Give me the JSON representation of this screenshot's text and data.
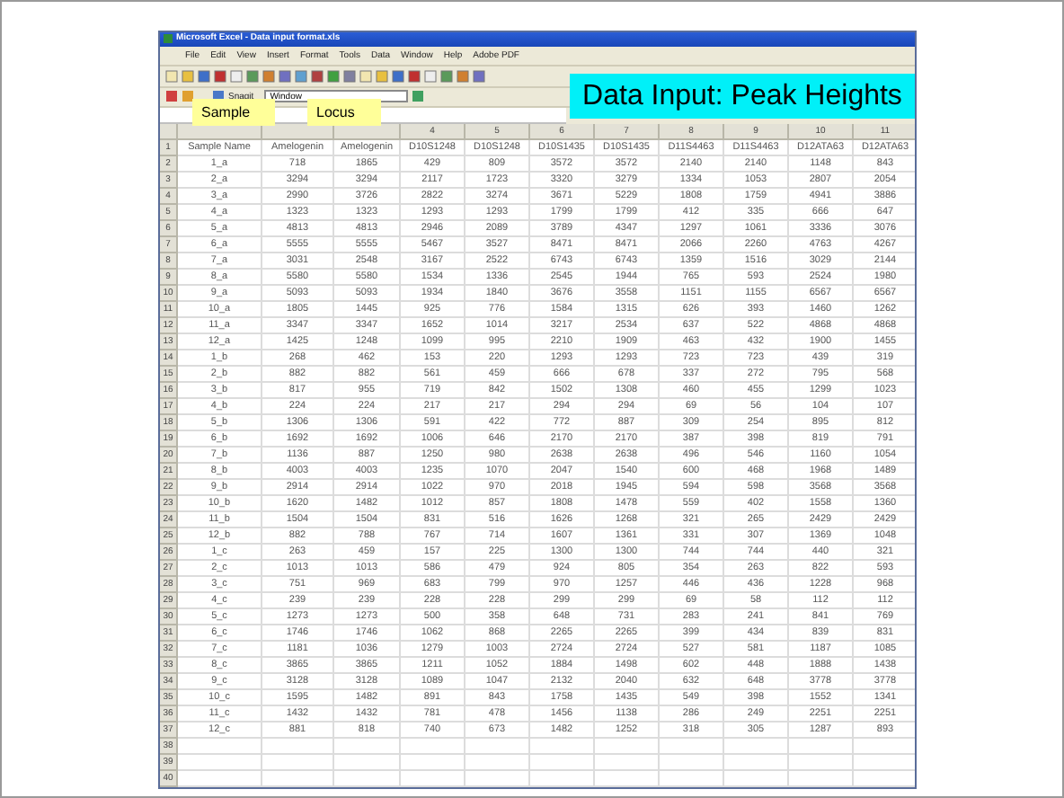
{
  "window": {
    "title": "Microsoft Excel - Data input format.xls"
  },
  "menu": [
    "File",
    "Edit",
    "View",
    "Insert",
    "Format",
    "Tools",
    "Data",
    "Window",
    "Help",
    "Adobe PDF"
  ],
  "toolbar2": {
    "snagit": "Snagit",
    "window_box": "Window"
  },
  "callouts": [
    {
      "kind": "title",
      "text": "Data Input: Peak Heights"
    },
    {
      "kind": "sample",
      "text": "Sample"
    },
    {
      "kind": "locus",
      "text": "Locus"
    }
  ],
  "column_headers": [
    "4",
    "5",
    "6",
    "7",
    "8",
    "9",
    "10",
    "11"
  ],
  "rows": [
    {
      "number": "1",
      "cells": [
        "Sample Name",
        "Amelogenin",
        "Amelogenin",
        "D10S1248",
        "D10S1248",
        "D10S1435",
        "D10S1435",
        "D11S4463",
        "D11S4463",
        "D12ATA63",
        "D12ATA63"
      ]
    },
    {
      "number": "2",
      "cells": [
        "1_a",
        "718",
        "1865",
        "429",
        "809",
        "3572",
        "3572",
        "2140",
        "2140",
        "1148",
        "843"
      ]
    },
    {
      "number": "3",
      "cells": [
        "2_a",
        "3294",
        "3294",
        "2117",
        "1723",
        "3320",
        "3279",
        "1334",
        "1053",
        "2807",
        "2054"
      ]
    },
    {
      "number": "4",
      "cells": [
        "3_a",
        "2990",
        "3726",
        "2822",
        "3274",
        "3671",
        "5229",
        "1808",
        "1759",
        "4941",
        "3886"
      ]
    },
    {
      "number": "5",
      "cells": [
        "4_a",
        "1323",
        "1323",
        "1293",
        "1293",
        "1799",
        "1799",
        "412",
        "335",
        "666",
        "647"
      ]
    },
    {
      "number": "6",
      "cells": [
        "5_a",
        "4813",
        "4813",
        "2946",
        "2089",
        "3789",
        "4347",
        "1297",
        "1061",
        "3336",
        "3076"
      ]
    },
    {
      "number": "7",
      "cells": [
        "6_a",
        "5555",
        "5555",
        "5467",
        "3527",
        "8471",
        "8471",
        "2066",
        "2260",
        "4763",
        "4267"
      ]
    },
    {
      "number": "8",
      "cells": [
        "7_a",
        "3031",
        "2548",
        "3167",
        "2522",
        "6743",
        "6743",
        "1359",
        "1516",
        "3029",
        "2144"
      ]
    },
    {
      "number": "9",
      "cells": [
        "8_a",
        "5580",
        "5580",
        "1534",
        "1336",
        "2545",
        "1944",
        "765",
        "593",
        "2524",
        "1980"
      ]
    },
    {
      "number": "10",
      "cells": [
        "9_a",
        "5093",
        "5093",
        "1934",
        "1840",
        "3676",
        "3558",
        "1151",
        "1155",
        "6567",
        "6567"
      ]
    },
    {
      "number": "11",
      "cells": [
        "10_a",
        "1805",
        "1445",
        "925",
        "776",
        "1584",
        "1315",
        "626",
        "393",
        "1460",
        "1262"
      ]
    },
    {
      "number": "12",
      "cells": [
        "11_a",
        "3347",
        "3347",
        "1652",
        "1014",
        "3217",
        "2534",
        "637",
        "522",
        "4868",
        "4868"
      ]
    },
    {
      "number": "13",
      "cells": [
        "12_a",
        "1425",
        "1248",
        "1099",
        "995",
        "2210",
        "1909",
        "463",
        "432",
        "1900",
        "1455"
      ]
    },
    {
      "number": "14",
      "cells": [
        "1_b",
        "268",
        "462",
        "153",
        "220",
        "1293",
        "1293",
        "723",
        "723",
        "439",
        "319"
      ]
    },
    {
      "number": "15",
      "cells": [
        "2_b",
        "882",
        "882",
        "561",
        "459",
        "666",
        "678",
        "337",
        "272",
        "795",
        "568"
      ]
    },
    {
      "number": "16",
      "cells": [
        "3_b",
        "817",
        "955",
        "719",
        "842",
        "1502",
        "1308",
        "460",
        "455",
        "1299",
        "1023"
      ]
    },
    {
      "number": "17",
      "cells": [
        "4_b",
        "224",
        "224",
        "217",
        "217",
        "294",
        "294",
        "69",
        "56",
        "104",
        "107"
      ]
    },
    {
      "number": "18",
      "cells": [
        "5_b",
        "1306",
        "1306",
        "591",
        "422",
        "772",
        "887",
        "309",
        "254",
        "895",
        "812"
      ]
    },
    {
      "number": "19",
      "cells": [
        "6_b",
        "1692",
        "1692",
        "1006",
        "646",
        "2170",
        "2170",
        "387",
        "398",
        "819",
        "791"
      ]
    },
    {
      "number": "20",
      "cells": [
        "7_b",
        "1136",
        "887",
        "1250",
        "980",
        "2638",
        "2638",
        "496",
        "546",
        "1160",
        "1054"
      ]
    },
    {
      "number": "21",
      "cells": [
        "8_b",
        "4003",
        "4003",
        "1235",
        "1070",
        "2047",
        "1540",
        "600",
        "468",
        "1968",
        "1489"
      ]
    },
    {
      "number": "22",
      "cells": [
        "9_b",
        "2914",
        "2914",
        "1022",
        "970",
        "2018",
        "1945",
        "594",
        "598",
        "3568",
        "3568"
      ]
    },
    {
      "number": "23",
      "cells": [
        "10_b",
        "1620",
        "1482",
        "1012",
        "857",
        "1808",
        "1478",
        "559",
        "402",
        "1558",
        "1360"
      ]
    },
    {
      "number": "24",
      "cells": [
        "11_b",
        "1504",
        "1504",
        "831",
        "516",
        "1626",
        "1268",
        "321",
        "265",
        "2429",
        "2429"
      ]
    },
    {
      "number": "25",
      "cells": [
        "12_b",
        "882",
        "788",
        "767",
        "714",
        "1607",
        "1361",
        "331",
        "307",
        "1369",
        "1048"
      ]
    },
    {
      "number": "26",
      "cells": [
        "1_c",
        "263",
        "459",
        "157",
        "225",
        "1300",
        "1300",
        "744",
        "744",
        "440",
        "321"
      ]
    },
    {
      "number": "27",
      "cells": [
        "2_c",
        "1013",
        "1013",
        "586",
        "479",
        "924",
        "805",
        "354",
        "263",
        "822",
        "593"
      ]
    },
    {
      "number": "28",
      "cells": [
        "3_c",
        "751",
        "969",
        "683",
        "799",
        "970",
        "1257",
        "446",
        "436",
        "1228",
        "968"
      ]
    },
    {
      "number": "29",
      "cells": [
        "4_c",
        "239",
        "239",
        "228",
        "228",
        "299",
        "299",
        "69",
        "58",
        "112",
        "112"
      ]
    },
    {
      "number": "30",
      "cells": [
        "5_c",
        "1273",
        "1273",
        "500",
        "358",
        "648",
        "731",
        "283",
        "241",
        "841",
        "769"
      ]
    },
    {
      "number": "31",
      "cells": [
        "6_c",
        "1746",
        "1746",
        "1062",
        "868",
        "2265",
        "2265",
        "399",
        "434",
        "839",
        "831"
      ]
    },
    {
      "number": "32",
      "cells": [
        "7_c",
        "1181",
        "1036",
        "1279",
        "1003",
        "2724",
        "2724",
        "527",
        "581",
        "1187",
        "1085"
      ]
    },
    {
      "number": "33",
      "cells": [
        "8_c",
        "3865",
        "3865",
        "1211",
        "1052",
        "1884",
        "1498",
        "602",
        "448",
        "1888",
        "1438"
      ]
    },
    {
      "number": "34",
      "cells": [
        "9_c",
        "3128",
        "3128",
        "1089",
        "1047",
        "2132",
        "2040",
        "632",
        "648",
        "3778",
        "3778"
      ]
    },
    {
      "number": "35",
      "cells": [
        "10_c",
        "1595",
        "1482",
        "891",
        "843",
        "1758",
        "1435",
        "549",
        "398",
        "1552",
        "1341"
      ]
    },
    {
      "number": "36",
      "cells": [
        "11_c",
        "1432",
        "1432",
        "781",
        "478",
        "1456",
        "1138",
        "286",
        "249",
        "2251",
        "2251"
      ]
    },
    {
      "number": "37",
      "cells": [
        "12_c",
        "881",
        "818",
        "740",
        "673",
        "1482",
        "1252",
        "318",
        "305",
        "1287",
        "893"
      ]
    },
    {
      "number": "38",
      "cells": []
    },
    {
      "number": "39",
      "cells": []
    },
    {
      "number": "40",
      "cells": []
    }
  ]
}
